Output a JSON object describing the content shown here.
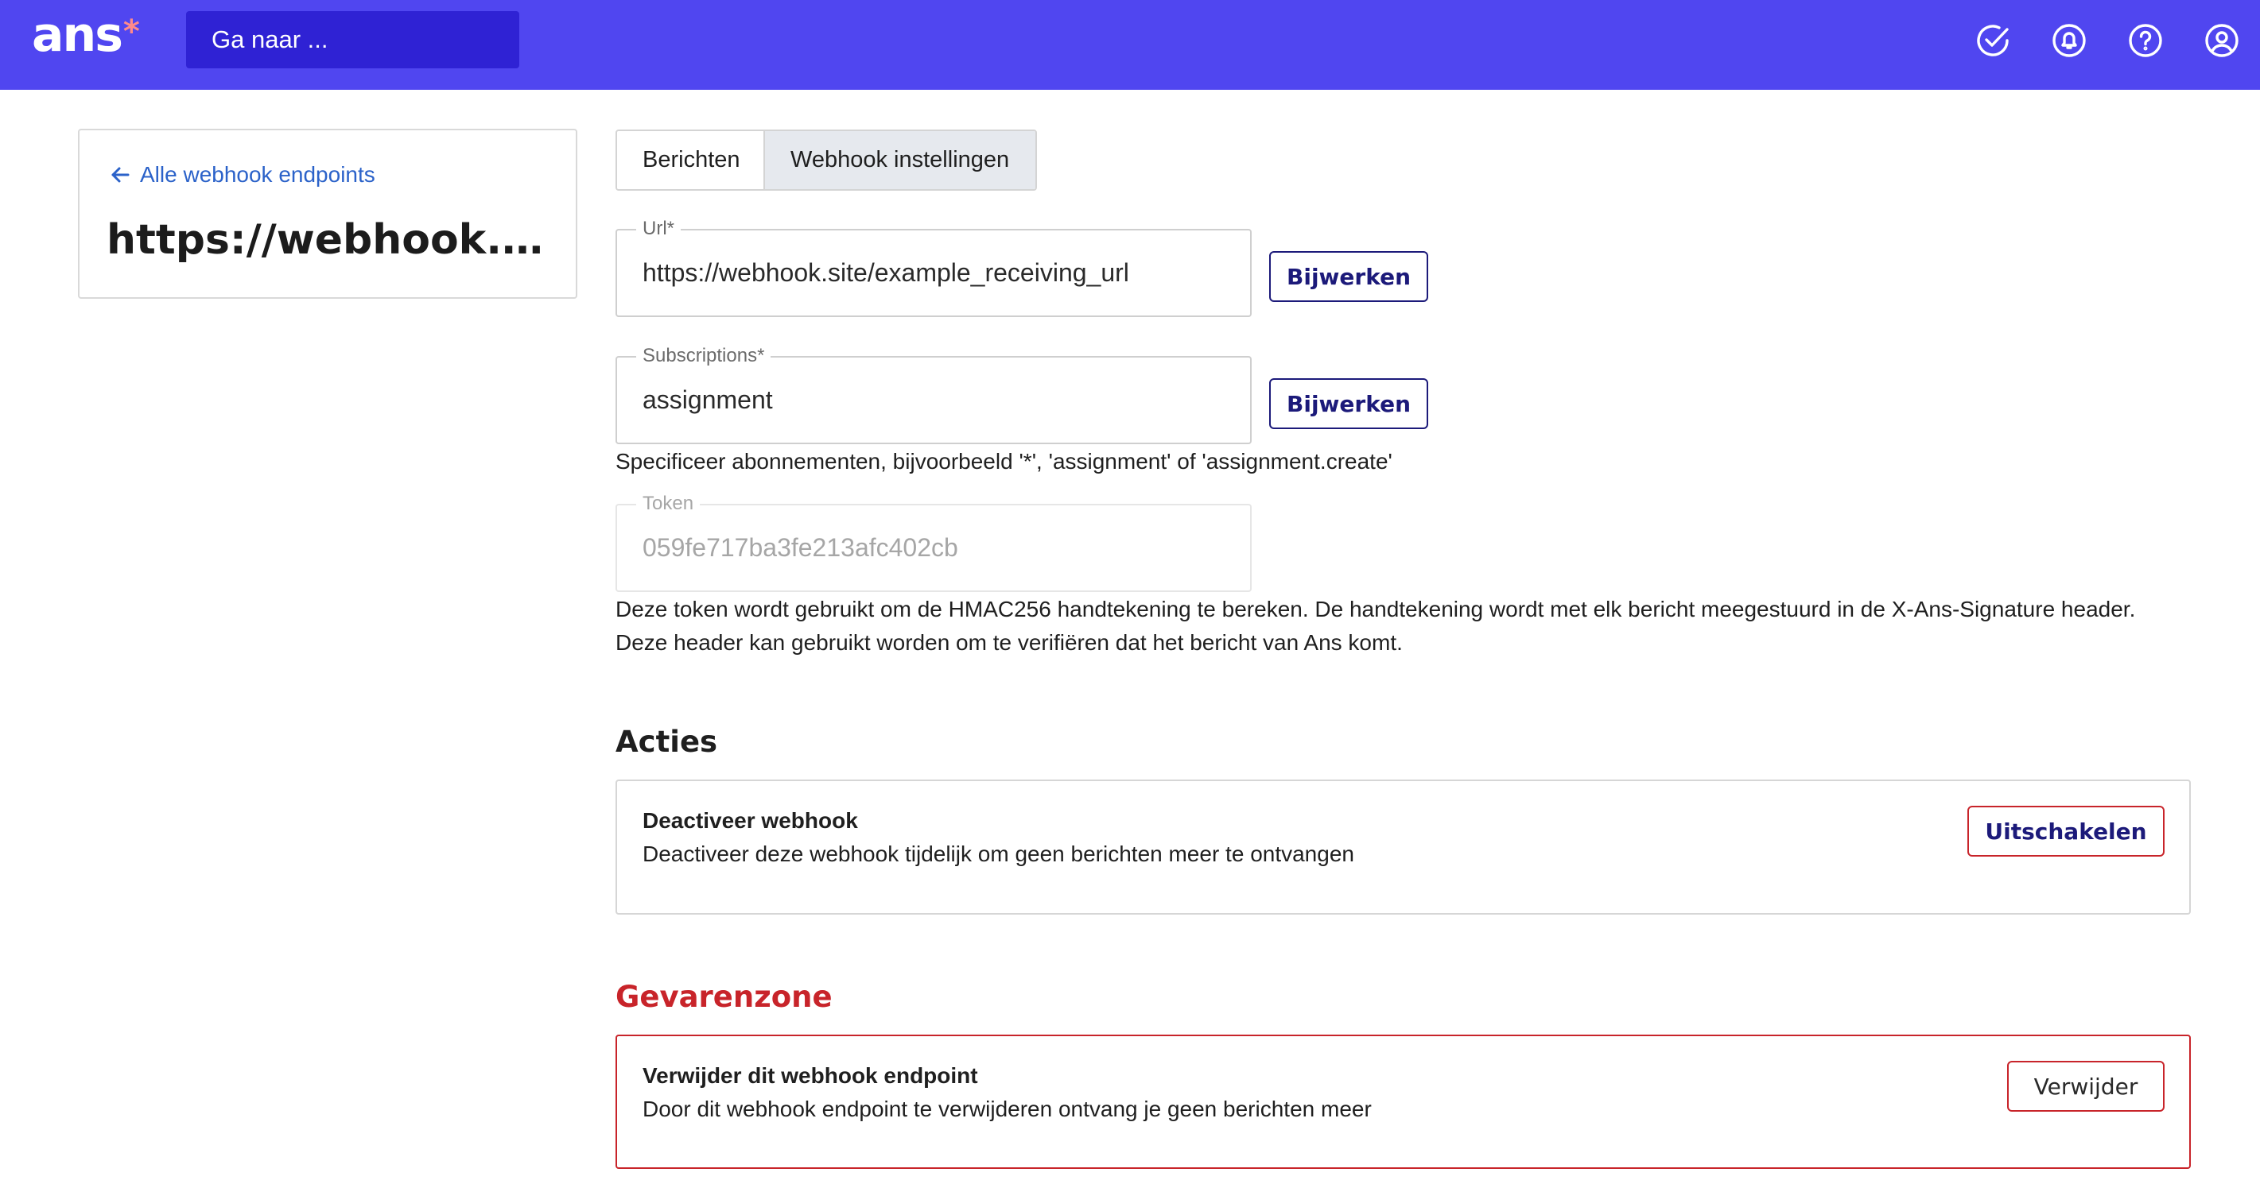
{
  "header": {
    "logo_text": "ans",
    "logo_star": "*",
    "goto_label": "Ga naar ...",
    "icons": [
      "check-circle-icon",
      "bell-icon",
      "help-icon",
      "user-icon"
    ]
  },
  "sidebar": {
    "back_label": "Alle webhook endpoints",
    "endpoint_title": "https://webhook.site/example_receiving_url"
  },
  "tabs": [
    {
      "label": "Berichten",
      "active": false
    },
    {
      "label": "Webhook instellingen",
      "active": true
    }
  ],
  "form": {
    "url": {
      "label": "Url*",
      "value": "https://webhook.site/example_receiving_url",
      "button": "Bijwerken"
    },
    "subscriptions": {
      "label": "Subscriptions*",
      "value": "assignment",
      "button": "Bijwerken",
      "help": "Specificeer abonnementen, bijvoorbeeld '*', 'assignment' of 'assignment.create'"
    },
    "token": {
      "label": "Token",
      "value": "059fe717ba3fe213afc402cb",
      "help_line1": "Deze token wordt gebruikt om de HMAC256 handtekening te bereken. De handtekening wordt met elk bericht meegestuurd in de X-Ans-Signature header.",
      "help_line2": "Deze header kan gebruikt worden om te verifiëren dat het bericht van Ans komt."
    }
  },
  "actions": {
    "title": "Acties",
    "deactivate": {
      "title": "Deactiveer webhook",
      "description": "Deactiveer deze webhook tijdelijk om geen berichten meer te ontvangen",
      "button": "Uitschakelen"
    }
  },
  "danger_zone": {
    "title": "Gevarenzone",
    "delete": {
      "title": "Verwijder dit webhook endpoint",
      "description": "Door dit webhook endpoint te verwijderen ontvang je geen berichten meer",
      "button": "Verwijder"
    }
  },
  "colors": {
    "brand": "#5046f0",
    "search_bg": "#2f22d4",
    "link": "#2b62c9",
    "primary_dark": "#1c1a7a",
    "danger": "#c8242a"
  }
}
